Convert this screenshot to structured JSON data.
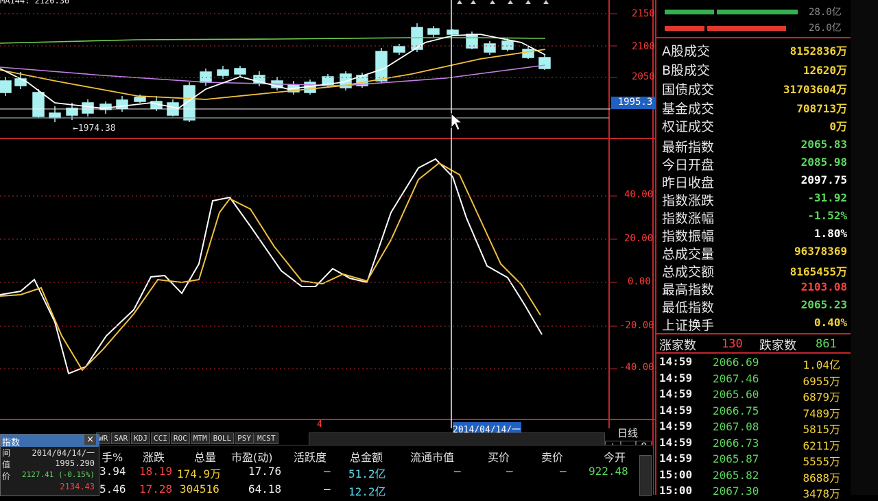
{
  "top_left_text": "MA144: 2120.36",
  "candle_axis": [
    "2150",
    "2100",
    "2050"
  ],
  "crosshair_value": "1995.3",
  "low_marker": "←1974.38",
  "osc_axis": [
    "40.00",
    "20.00",
    "0.00",
    "-20.00",
    "-40.00"
  ],
  "bottom_index_label": "4",
  "crosshair_date": "2014/04/14/一",
  "period_label": "日线",
  "period_controls": [
    "+",
    "-",
    "0"
  ],
  "indicator_tabs": [
    "WR",
    "SAR",
    "KDJ",
    "CCI",
    "ROC",
    "MTM",
    "BOLL",
    "PSY",
    "MCST"
  ],
  "bar_strip": [
    {
      "label": "28.0亿",
      "color": "#35b050"
    },
    {
      "label": "26.0亿",
      "color": "#e03a30"
    }
  ],
  "market_stats": [
    {
      "label": "A股成交",
      "value": "8152836万",
      "color": "#f2d23a"
    },
    {
      "label": "B股成交",
      "value": "12620万",
      "color": "#f2d23a"
    },
    {
      "label": "国债成交",
      "value": "31703604万",
      "color": "#f2d23a"
    },
    {
      "label": "基金成交",
      "value": "708713万",
      "color": "#f2d23a"
    },
    {
      "label": "权证成交",
      "value": "0万",
      "color": "#f2d23a"
    }
  ],
  "index_stats": [
    {
      "label": "最新指数",
      "value": "2065.83",
      "color": "#5dd85d"
    },
    {
      "label": "今日开盘",
      "value": "2085.98",
      "color": "#5dd85d"
    },
    {
      "label": "昨日收盘",
      "value": "2097.75",
      "color": "#ffffff"
    },
    {
      "label": "指数涨跌",
      "value": "-31.92",
      "color": "#5dd85d"
    },
    {
      "label": "指数涨幅",
      "value": "-1.52%",
      "color": "#5dd85d"
    },
    {
      "label": "指数振幅",
      "value": "1.80%",
      "color": "#ffffff"
    },
    {
      "label": "总成交量",
      "value": "96378369",
      "color": "#f2d23a"
    },
    {
      "label": "总成交额",
      "value": "8165455万",
      "color": "#f2d23a"
    },
    {
      "label": "最高指数",
      "value": "2103.08",
      "color": "#ff4040"
    },
    {
      "label": "最低指数",
      "value": "2065.23",
      "color": "#5dd85d"
    },
    {
      "label": "上证换手",
      "value": "0.40%",
      "color": "#f2d23a"
    }
  ],
  "updown": {
    "up_label": "涨家数",
    "up_value": "130",
    "down_label": "跌家数",
    "down_value": "861"
  },
  "ticks": [
    {
      "time": "14:59",
      "price": "2066.69",
      "vol": "1.04亿"
    },
    {
      "time": "14:59",
      "price": "2067.46",
      "vol": "6955万"
    },
    {
      "time": "14:59",
      "price": "2065.60",
      "vol": "6879万"
    },
    {
      "time": "14:59",
      "price": "2066.75",
      "vol": "7489万"
    },
    {
      "time": "14:59",
      "price": "2067.08",
      "vol": "5815万"
    },
    {
      "time": "14:59",
      "price": "2066.73",
      "vol": "6211万"
    },
    {
      "time": "14:59",
      "price": "2065.87",
      "vol": "5555万"
    },
    {
      "time": "15:00",
      "price": "2065.82",
      "vol": "8688万"
    },
    {
      "time": "15:00",
      "price": "2067.30",
      "vol": "3478万"
    }
  ],
  "table": {
    "headers": [
      "手%",
      "涨跌",
      "总量",
      "市盈(动)",
      "活跃度",
      "总金额",
      "流通市值",
      "买价",
      "卖价",
      "今开"
    ],
    "rows": [
      [
        "3.94",
        "18.19",
        "174.9万",
        "17.76",
        "–",
        "51.2亿",
        "–",
        "–",
        "–",
        "922.48"
      ],
      [
        "5.46",
        "17.28",
        "304516",
        "64.18",
        "–",
        "12.2亿",
        "",
        "",
        "",
        ""
      ]
    ]
  },
  "popup": {
    "title": "指数",
    "close": "×",
    "rows": [
      {
        "label": "间",
        "value": "2014/04/14/一",
        "color": "#e0e0e0"
      },
      {
        "label": "值",
        "value": "1995.290",
        "color": "#e0e0e0"
      },
      {
        "label": "价",
        "value": "2127.41 (-0.15%)",
        "color": "#5dd85d"
      },
      {
        "label": "",
        "value": "2134.43",
        "color": "#ff4040"
      }
    ]
  },
  "colors": {
    "grid": "#c0262b",
    "up": "#ff3030",
    "down": "#a9f0f0",
    "ma_white": "#ffffff",
    "ma_yellow": "#f0c040",
    "ma_purple": "#c080e0",
    "ma_green": "#70d050"
  }
}
